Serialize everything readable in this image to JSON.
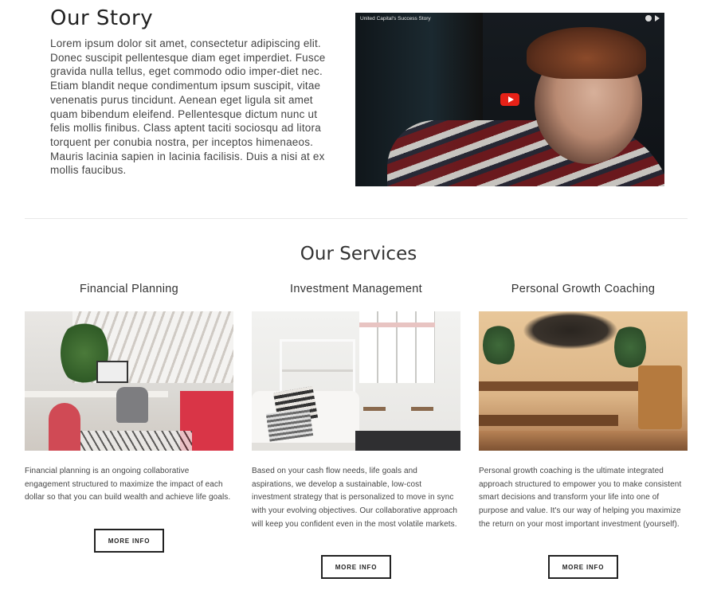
{
  "story": {
    "title": "Our Story",
    "body": "Lorem ipsum dolor sit amet, consectetur adipiscing elit. Donec suscipit pellentesque diam eget imperdiet. Fusce gravida nulla tellus, eget commodo odio imper-diet nec. Etiam blandit neque condimentum ipsum suscipit, vitae venenatis purus tincidunt. Aenean eget ligula sit amet quam bibendum eleifend. Pellentesque dictum nunc ut felis mollis finibus. Class aptent taciti sociosqu ad litora torquent per conubia nostra, per inceptos himenaeos. Mauris lacinia sapien in lacinia facilisis. Duis a nisi at ex mollis faucibus.",
    "video_title": "United Capital's Success Story"
  },
  "services": {
    "title": "Our Services",
    "items": [
      {
        "name": "Financial Planning",
        "description": "Financial planning is an ongoing collaborative engagement structured to maximize the impact of each dollar so that you can build wealth and achieve life goals.",
        "button": "MORE INFO"
      },
      {
        "name": "Investment Management",
        "description": "Based on your cash flow needs, life goals and aspirations, we develop a sustainable, low-cost investment strategy that is personalized to move in sync with your evolving objectives.  Our collaborative approach will keep you confident even in the most volatile markets.",
        "button": "MORE INFO"
      },
      {
        "name": "Personal Growth Coaching",
        "description": "Personal growth coaching is the ultimate integrated approach structured to empower you to make consistent smart decisions and transform your life into one of purpose and value.  It's our way of helping you maximize the return on your most important investment (yourself).",
        "button": "MORE INFO"
      }
    ]
  },
  "colors": {
    "play_button": "#e62117",
    "text": "#444444",
    "divider": "#e8e8e8"
  },
  "icons": [
    "youtube-play-icon",
    "clock-icon",
    "share-icon"
  ]
}
